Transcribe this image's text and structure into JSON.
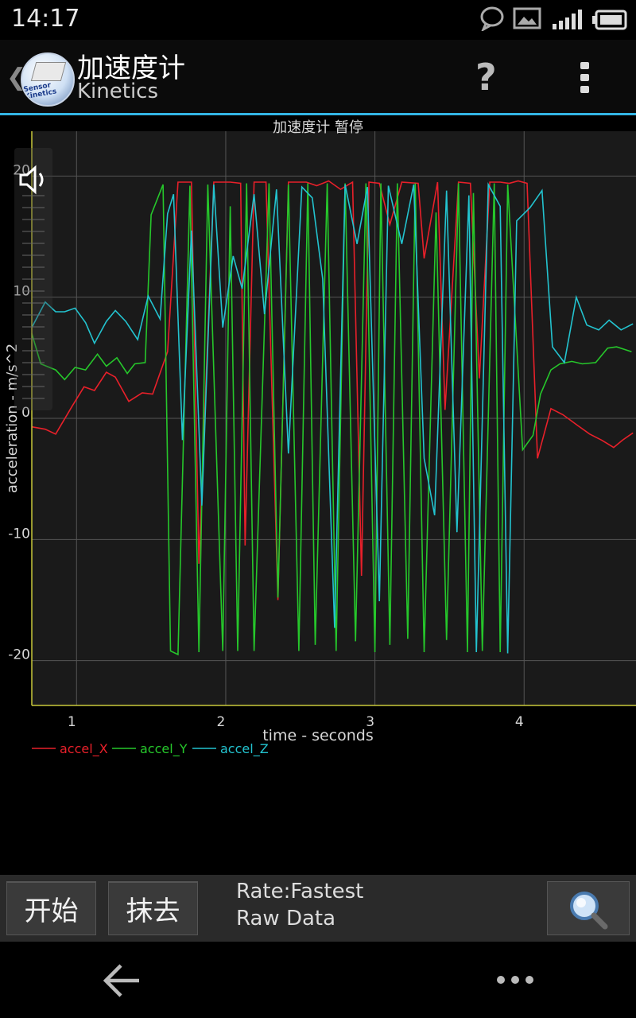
{
  "status": {
    "time": "14:17"
  },
  "action_bar": {
    "title": "加速度计",
    "subtitle": "Kinetics",
    "app_icon_label": "Sensor Kinetics",
    "help_glyph": "?"
  },
  "chart": {
    "header": "加速度计 暂停"
  },
  "controls": {
    "start_label": "开始",
    "clear_label": "抹去",
    "rate_text": "Rate:Fastest",
    "mode_text": "Raw Data"
  },
  "chart_data": {
    "type": "line",
    "xlabel": "time - seconds",
    "ylabel": "acceleration - m/s^2",
    "xlim": [
      0.7,
      4.75
    ],
    "ylim": [
      -23.7,
      23.7
    ],
    "x_ticks": [
      "1",
      "2",
      "3",
      "4"
    ],
    "y_ticks": [
      "20",
      "10",
      "0",
      "-10",
      "-20"
    ],
    "grid": true,
    "legend_position": "bottom-left",
    "series": [
      {
        "name": "accel_X",
        "color": "#e8202a",
        "x": [
          0.7,
          0.79,
          0.86,
          0.97,
          1.05,
          1.12,
          1.2,
          1.26,
          1.35,
          1.44,
          1.51,
          1.61,
          1.68,
          1.77,
          1.82,
          1.92,
          2.03,
          2.1,
          2.13,
          2.19,
          2.27,
          2.35,
          2.42,
          2.54,
          2.61,
          2.69,
          2.77,
          2.85,
          2.91,
          2.96,
          3.03,
          3.1,
          3.18,
          3.29,
          3.33,
          3.42,
          3.47,
          3.56,
          3.64,
          3.7,
          3.77,
          3.84,
          3.9,
          3.96,
          4.02,
          4.09,
          4.18,
          4.26,
          4.36,
          4.44,
          4.52,
          4.6,
          4.66,
          4.73
        ],
        "y": [
          -0.7,
          -0.9,
          -1.3,
          1.0,
          2.6,
          2.3,
          3.8,
          3.4,
          1.4,
          2.1,
          2.0,
          5.5,
          19.5,
          19.5,
          -12.0,
          19.5,
          19.5,
          19.4,
          -10.5,
          19.5,
          19.5,
          -15.0,
          19.5,
          19.5,
          19.2,
          19.6,
          18.9,
          19.5,
          -13.0,
          19.5,
          19.4,
          16.0,
          19.5,
          19.4,
          13.2,
          19.5,
          0.7,
          19.5,
          19.4,
          3.3,
          19.5,
          19.5,
          19.4,
          19.6,
          19.4,
          -3.3,
          0.8,
          0.3,
          -0.6,
          -1.3,
          -1.8,
          -2.4,
          -1.8,
          -1.2
        ]
      },
      {
        "name": "accel_Y",
        "color": "#26c72b",
        "x": [
          0.7,
          0.76,
          0.86,
          0.92,
          0.99,
          1.06,
          1.14,
          1.2,
          1.27,
          1.34,
          1.39,
          1.46,
          1.5,
          1.58,
          1.63,
          1.68,
          1.76,
          1.82,
          1.88,
          1.98,
          2.03,
          2.08,
          2.14,
          2.19,
          2.29,
          2.35,
          2.42,
          2.49,
          2.55,
          2.6,
          2.68,
          2.74,
          2.8,
          2.87,
          2.94,
          3.0,
          3.04,
          3.1,
          3.15,
          3.22,
          3.27,
          3.33,
          3.41,
          3.48,
          3.56,
          3.62,
          3.66,
          3.72,
          3.8,
          3.84,
          3.89,
          3.99,
          4.06,
          4.11,
          4.18,
          4.24,
          4.32,
          4.39,
          4.48,
          4.56,
          4.62,
          4.72
        ],
        "y": [
          7.0,
          4.5,
          4.0,
          3.2,
          4.2,
          4.0,
          5.3,
          4.3,
          5.0,
          3.7,
          4.5,
          4.6,
          16.8,
          19.3,
          -19.2,
          -19.5,
          19.2,
          -19.3,
          19.3,
          -19.2,
          17.5,
          -19.2,
          19.4,
          -19.2,
          19.4,
          -14.8,
          19.3,
          -19.2,
          19.4,
          -18.7,
          19.4,
          -19.2,
          19.4,
          -18.4,
          19.4,
          -19.3,
          19.4,
          -18.7,
          19.4,
          -18.2,
          19.4,
          -19.3,
          17.0,
          -18.3,
          19.4,
          -19.3,
          18.6,
          -19.2,
          19.4,
          -19.3,
          19.3,
          -2.6,
          -1.4,
          2.0,
          4.0,
          4.5,
          4.7,
          4.5,
          4.6,
          5.8,
          5.9,
          5.5
        ]
      },
      {
        "name": "accel_Z",
        "color": "#23c3cf",
        "x": [
          0.7,
          0.79,
          0.86,
          0.92,
          0.99,
          1.06,
          1.12,
          1.2,
          1.26,
          1.33,
          1.41,
          1.48,
          1.56,
          1.61,
          1.65,
          1.71,
          1.77,
          1.84,
          1.92,
          1.98,
          2.05,
          2.11,
          2.19,
          2.26,
          2.34,
          2.42,
          2.51,
          2.58,
          2.65,
          2.73,
          2.8,
          2.88,
          2.95,
          3.03,
          3.09,
          3.18,
          3.26,
          3.33,
          3.4,
          3.48,
          3.55,
          3.63,
          3.68,
          3.76,
          3.84,
          3.89,
          3.95,
          4.04,
          4.12,
          4.19,
          4.27,
          4.35,
          4.42,
          4.5,
          4.57,
          4.65,
          4.73
        ],
        "y": [
          7.5,
          9.6,
          8.8,
          8.8,
          9.1,
          7.9,
          6.2,
          8.0,
          8.9,
          8.0,
          6.5,
          10.1,
          8.2,
          16.9,
          18.5,
          -1.8,
          15.5,
          -7.2,
          19.3,
          7.5,
          13.4,
          10.7,
          18.5,
          8.6,
          18.9,
          -2.9,
          19.1,
          18.2,
          11.5,
          -17.3,
          19.3,
          14.4,
          19.1,
          -15.1,
          19.2,
          14.4,
          19.3,
          -3.3,
          -8.0,
          18.8,
          -9.4,
          18.4,
          -19.3,
          19.3,
          17.5,
          -19.4,
          16.3,
          17.4,
          18.8,
          5.9,
          4.6,
          10.0,
          7.7,
          7.3,
          8.1,
          7.3,
          7.8
        ]
      }
    ]
  }
}
